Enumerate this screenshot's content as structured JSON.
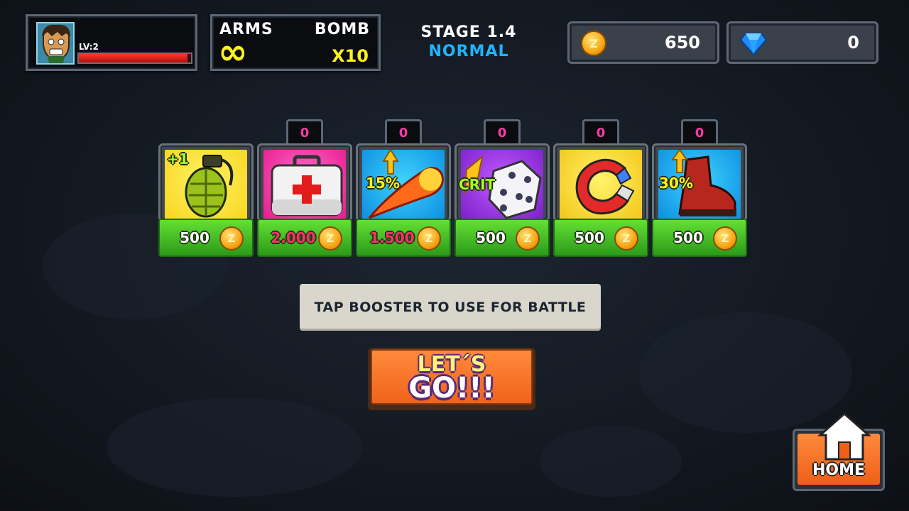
{
  "player": {
    "level_label": "LV:2",
    "hp_fraction": 0.97
  },
  "weapons": {
    "arms_label": "ARMS",
    "arms_value": "∞",
    "bomb_label": "BOMB",
    "bomb_value": "X10"
  },
  "stage": {
    "title": "STAGE 1.4",
    "mode": "NORMAL"
  },
  "currency": {
    "coins": "650",
    "gems": "0"
  },
  "boosters": [
    {
      "name": "grenade",
      "tag": "+1",
      "price": "500",
      "price_color": "white"
    },
    {
      "name": "medkit",
      "owned": "0",
      "price": "2.000",
      "price_color": "pink"
    },
    {
      "name": "fireball",
      "owned": "0",
      "tag": "15%",
      "price": "1.500",
      "price_color": "pink"
    },
    {
      "name": "dice",
      "owned": "0",
      "tag": "CRIT",
      "price": "500",
      "price_color": "white"
    },
    {
      "name": "magnet",
      "owned": "0",
      "price": "500",
      "price_color": "white"
    },
    {
      "name": "boot",
      "owned": "0",
      "tag": "30%",
      "price": "500",
      "price_color": "white"
    }
  ],
  "hint": "TAP BOOSTER TO USE FOR BATTLE",
  "go_button": {
    "line1": "LET´S",
    "line2": "GO!!!"
  },
  "home_button": {
    "label": "HOME"
  },
  "colors": {
    "accent_green": "#4cc42a",
    "stage_mode": "#1fb4ff",
    "go_orange": "#f0631b",
    "price_pink": "#ff2f6c"
  }
}
